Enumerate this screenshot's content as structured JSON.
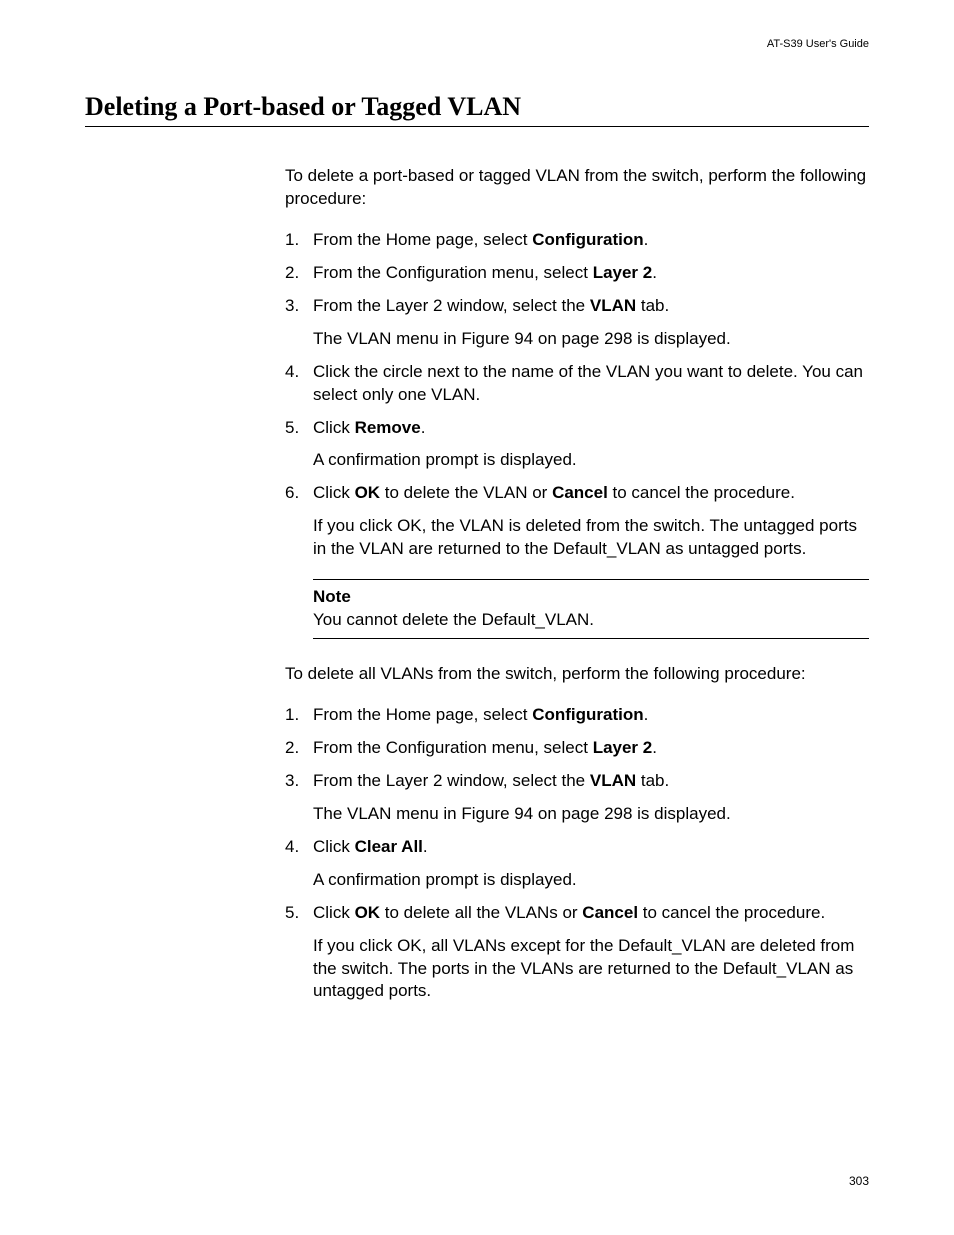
{
  "header": "AT-S39 User's Guide",
  "title": "Deleting a Port-based or Tagged VLAN",
  "intro1": "To delete a port-based or tagged VLAN from the switch, perform the following procedure:",
  "list1": {
    "i1a": "From the Home page, select ",
    "i1b": "Configuration",
    "i1c": ".",
    "i2a": "From the Configuration menu, select ",
    "i2b": "Layer 2",
    "i2c": ".",
    "i3a": "From the Layer 2 window, select the ",
    "i3b": "VLAN",
    "i3c": " tab.",
    "i3sub": "The VLAN menu in Figure 94 on page 298 is displayed.",
    "i4": "Click the circle next to the name of the VLAN you want to delete. You can select only one VLAN.",
    "i5a": "Click ",
    "i5b": "Remove",
    "i5c": ".",
    "i5sub": "A confirmation prompt is displayed.",
    "i6a": "Click ",
    "i6b": "OK",
    "i6c": " to delete the VLAN or ",
    "i6d": "Cancel",
    "i6e": " to cancel the procedure.",
    "i6sub": "If you click OK, the VLAN is deleted from the switch. The untagged ports in the VLAN are returned to the Default_VLAN as untagged ports."
  },
  "note": {
    "title": "Note",
    "body": "You cannot delete the Default_VLAN."
  },
  "intro2": "To delete all VLANs from the switch, perform the following procedure:",
  "list2": {
    "i1a": "From the Home page, select ",
    "i1b": "Configuration",
    "i1c": ".",
    "i2a": "From the Configuration menu, select ",
    "i2b": "Layer 2",
    "i2c": ".",
    "i3a": "From the Layer 2 window, select the ",
    "i3b": "VLAN",
    "i3c": " tab.",
    "i3sub": "The VLAN menu in Figure 94 on page 298 is displayed.",
    "i4a": "Click ",
    "i4b": "Clear All",
    "i4c": ".",
    "i4sub": "A confirmation prompt is displayed.",
    "i5a": "Click ",
    "i5b": "OK",
    "i5c": " to delete all the VLANs or ",
    "i5d": "Cancel",
    "i5e": " to cancel the procedure.",
    "i5sub": "If you click OK, all VLANs except for the Default_VLAN are deleted from the switch. The ports in the VLANs are returned to the Default_VLAN as untagged ports."
  },
  "pageNumber": "303"
}
